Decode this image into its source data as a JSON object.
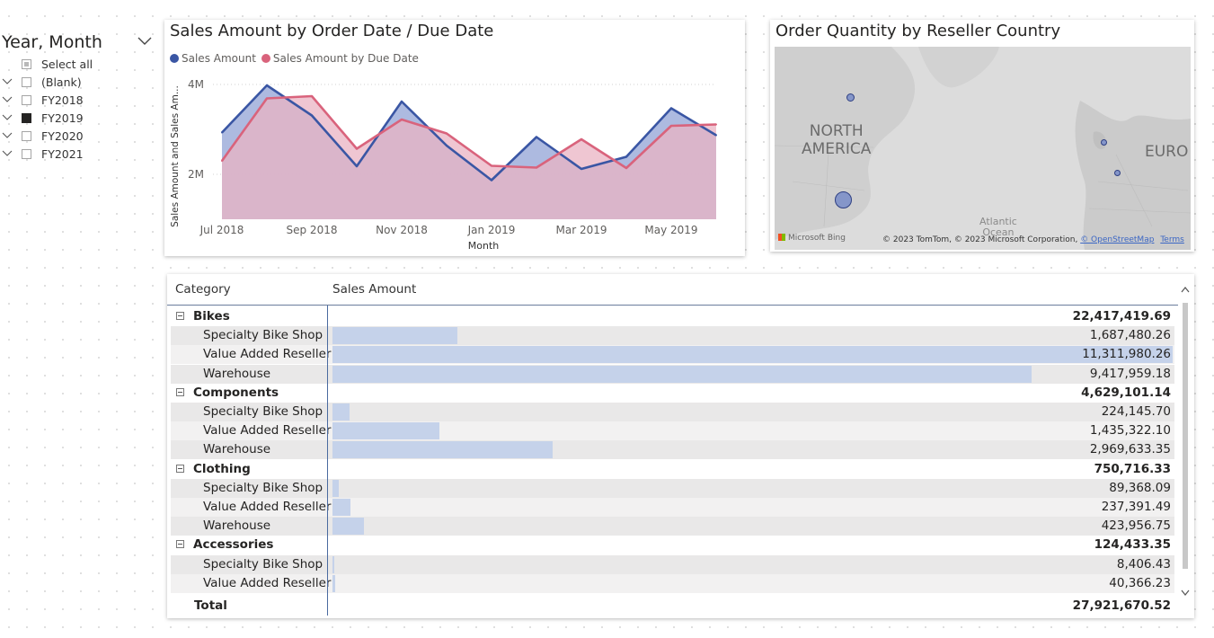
{
  "slicer": {
    "title": "Year, Month",
    "items": [
      {
        "label": "Select all",
        "state": "partial",
        "expandable": false
      },
      {
        "label": "(Blank)",
        "state": "unchecked",
        "expandable": true
      },
      {
        "label": "FY2018",
        "state": "unchecked",
        "expandable": true
      },
      {
        "label": "FY2019",
        "state": "checked",
        "expandable": true
      },
      {
        "label": "FY2020",
        "state": "unchecked",
        "expandable": true
      },
      {
        "label": "FY2021",
        "state": "unchecked",
        "expandable": true
      }
    ]
  },
  "line_chart": {
    "title": "Sales Amount by Order Date / Due Date",
    "legend": [
      "Sales Amount",
      "Sales Amount by Due Date"
    ]
  },
  "chart_data": {
    "type": "area",
    "title": "Sales Amount by Order Date / Due Date",
    "xlabel": "Month",
    "ylabel": "Sales Amount and Sales Am...",
    "x": [
      "Jul 2018",
      "Aug 2018",
      "Sep 2018",
      "Oct 2018",
      "Nov 2018",
      "Dec 2018",
      "Jan 2019",
      "Feb 2019",
      "Mar 2019",
      "Apr 2019",
      "May 2019",
      "Jun 2019"
    ],
    "x_tick_labels": [
      "Jul 2018",
      "Sep 2018",
      "Nov 2018",
      "Jan 2019",
      "Mar 2019",
      "May 2019"
    ],
    "y_tick_labels": [
      "2M",
      "4M"
    ],
    "ylim": [
      1000000,
      4200000
    ],
    "grid": true,
    "legend_position": "top-left",
    "series": [
      {
        "name": "Sales Amount",
        "color": "#3a56a4",
        "fill": "#a9b6de",
        "values": [
          2930000,
          3980000,
          3310000,
          2180000,
          3620000,
          2640000,
          1870000,
          2830000,
          2120000,
          2390000,
          3470000,
          2870000
        ]
      },
      {
        "name": "Sales Amount by Due Date",
        "color": "#d9637c",
        "fill": "#e9b3c3",
        "values": [
          2300000,
          3690000,
          3740000,
          2570000,
          3220000,
          2910000,
          2190000,
          2150000,
          2780000,
          2140000,
          3080000,
          3110000
        ]
      }
    ]
  },
  "map_card": {
    "title": "Order Quantity by Reseller Country",
    "labels": {
      "north_america": [
        "NORTH",
        "AMERICA"
      ],
      "europe": "EURO",
      "ocean": [
        "Atlantic",
        "Ocean"
      ]
    },
    "attribution": "© 2023 TomTom, © 2023 Microsoft Corporation,",
    "osm_link": "© OpenStreetMap",
    "terms_link": "Terms",
    "bing_logo": "Microsoft Bing",
    "bubble_color": "#8596c9"
  },
  "matrix": {
    "headers": {
      "category": "Category",
      "sales": "Sales Amount"
    },
    "bar_color": "#c5d2ea",
    "max_value": 11311980.26,
    "rows": [
      {
        "type": "group",
        "label": "Bikes",
        "value": "22,417,419.69"
      },
      {
        "type": "sub",
        "label": "Specialty Bike Shop",
        "value": "1,687,480.26",
        "amount": 1687480.26
      },
      {
        "type": "sub",
        "label": "Value Added Reseller",
        "value": "11,311,980.26",
        "amount": 11311980.26
      },
      {
        "type": "sub",
        "label": "Warehouse",
        "value": "9,417,959.18",
        "amount": 9417959.18
      },
      {
        "type": "group",
        "label": "Components",
        "value": "4,629,101.14"
      },
      {
        "type": "sub",
        "label": "Specialty Bike Shop",
        "value": "224,145.70",
        "amount": 224145.7
      },
      {
        "type": "sub",
        "label": "Value Added Reseller",
        "value": "1,435,322.10",
        "amount": 1435322.1
      },
      {
        "type": "sub",
        "label": "Warehouse",
        "value": "2,969,633.35",
        "amount": 2969633.35
      },
      {
        "type": "group",
        "label": "Clothing",
        "value": "750,716.33"
      },
      {
        "type": "sub",
        "label": "Specialty Bike Shop",
        "value": "89,368.09",
        "amount": 89368.09
      },
      {
        "type": "sub",
        "label": "Value Added Reseller",
        "value": "237,391.49",
        "amount": 237391.49
      },
      {
        "type": "sub",
        "label": "Warehouse",
        "value": "423,956.75",
        "amount": 423956.75
      },
      {
        "type": "group",
        "label": "Accessories",
        "value": "124,433.35"
      },
      {
        "type": "sub",
        "label": "Specialty Bike Shop",
        "value": "8,406.43",
        "amount": 8406.43
      },
      {
        "type": "sub",
        "label": "Value Added Reseller",
        "value": "40,366.23",
        "amount": 40366.23
      }
    ],
    "total": {
      "label": "Total",
      "value": "27,921,670.52"
    }
  }
}
